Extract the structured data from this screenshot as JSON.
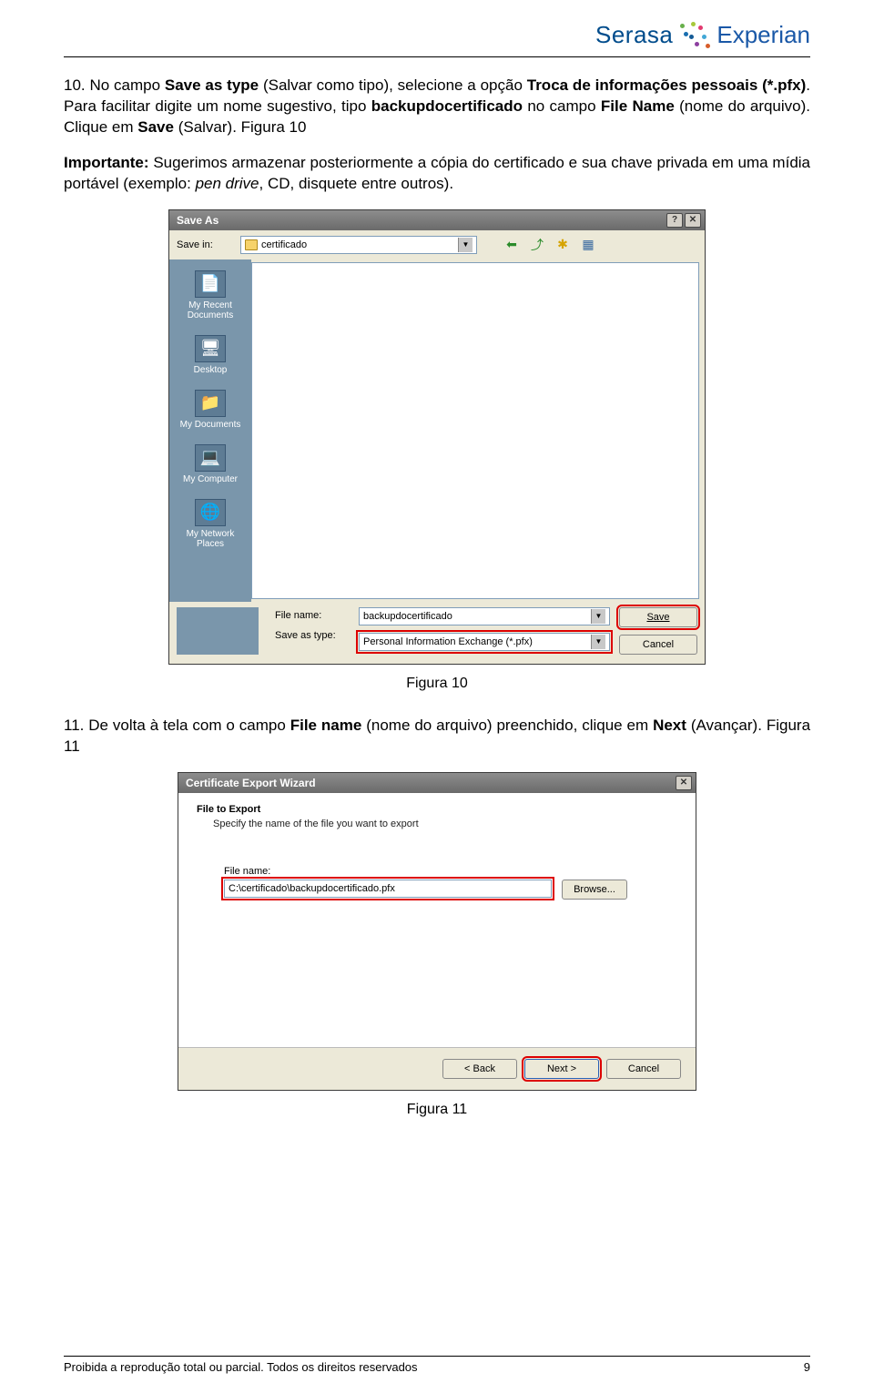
{
  "header": {
    "brand_left": "Serasa",
    "brand_right": "Experian"
  },
  "paragraphs": {
    "p10_a": "10. No campo ",
    "p10_b": "Save as type",
    "p10_c": " (Salvar como tipo), selecione a opção ",
    "p10_d": "Troca de informações pessoais (*.pfx)",
    "p10_e": ". Para facilitar digite um nome sugestivo, tipo ",
    "p10_f": "backupdocertificado",
    "p10_g": " no campo ",
    "p10_h": "File Name",
    "p10_i": " (nome do arquivo). Clique em ",
    "p10_j": "Save",
    "p10_k": " (Salvar). Figura 10",
    "imp_a": "Importante:",
    "imp_b": " Sugerimos armazenar posteriormente a cópia do certificado e sua chave privada em uma mídia portável (exemplo: ",
    "imp_c": "pen drive",
    "imp_d": ", CD, disquete entre outros).",
    "p11_a": "11. De volta à tela com o campo ",
    "p11_b": "File name",
    "p11_c": " (nome do arquivo) preenchido, clique em ",
    "p11_d": "Next",
    "p11_e": " (Avançar). Figura 11"
  },
  "save_dialog": {
    "title": "Save As",
    "help_glyph": "?",
    "close_glyph": "✕",
    "save_in_label": "Save in:",
    "folder_name": "certificado",
    "nav": {
      "back": "⬅",
      "up": "⤴",
      "new": "✱",
      "view": "▦"
    },
    "places": [
      {
        "label": "My Recent Documents",
        "glyph": "📄"
      },
      {
        "label": "Desktop",
        "glyph": "🖥"
      },
      {
        "label": "My Documents",
        "glyph": "📁"
      },
      {
        "label": "My Computer",
        "glyph": "💻"
      },
      {
        "label": "My Network Places",
        "glyph": "🌐"
      }
    ],
    "filename_label": "File name:",
    "filetype_label": "Save as type:",
    "filename_value": "backupdocertificado",
    "filetype_value": "Personal Information Exchange (*.pfx)",
    "save_btn": "Save",
    "cancel_btn": "Cancel"
  },
  "captions": {
    "fig10": "Figura 10",
    "fig11": "Figura 11"
  },
  "wizard": {
    "title": "Certificate Export Wizard",
    "close_glyph": "✕",
    "subtitle": "File to Export",
    "desc": "Specify the name of the file you want to export",
    "filename_label": "File name:",
    "filename_value": "C:\\certificado\\backupdocertificado.pfx",
    "browse_btn": "Browse...",
    "back_btn": "< Back",
    "next_btn": "Next >",
    "cancel_btn": "Cancel"
  },
  "footer": {
    "left": "Proibida a reprodução total ou parcial. Todos os direitos reservados",
    "right": "9"
  }
}
